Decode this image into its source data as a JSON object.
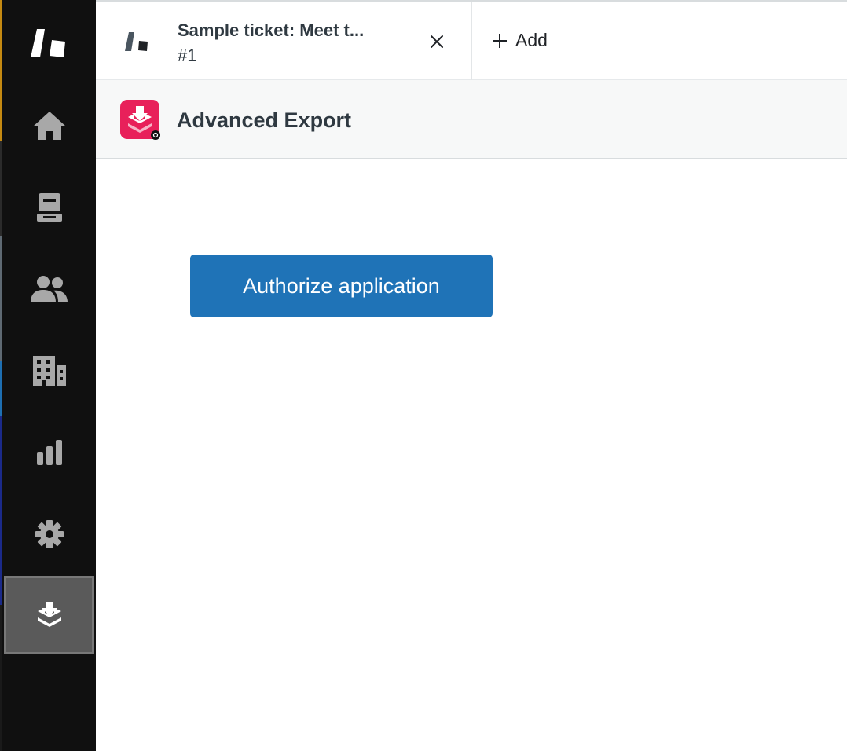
{
  "colors": {
    "sidebar_bg": "#101010",
    "sidebar_icon": "#a8a8a8",
    "active_nav_bg": "#5a5a5a",
    "primary_button": "#1f73b7",
    "app_logo_bg": "#e8205a",
    "header_bg": "#f7f8f8",
    "text_primary": "#2f3941"
  },
  "sidebar": {
    "items": [
      {
        "name": "zendesk-logo-icon"
      },
      {
        "name": "home-icon"
      },
      {
        "name": "views-inbox-icon"
      },
      {
        "name": "customers-icon"
      },
      {
        "name": "organizations-building-icon"
      },
      {
        "name": "reporting-bar-chart-icon"
      },
      {
        "name": "admin-gear-icon"
      },
      {
        "name": "advanced-export-app-icon",
        "active": true
      }
    ]
  },
  "tabs": {
    "ticket": {
      "title": "Sample ticket: Meet t...",
      "id": "#1",
      "icon": "ticket-logo-icon",
      "close_icon": "close-icon"
    },
    "add_label": "Add",
    "add_icon": "plus-icon"
  },
  "app": {
    "title": "Advanced Export",
    "logo_icon": "advanced-export-logo-icon"
  },
  "content": {
    "authorize_label": "Authorize application"
  }
}
